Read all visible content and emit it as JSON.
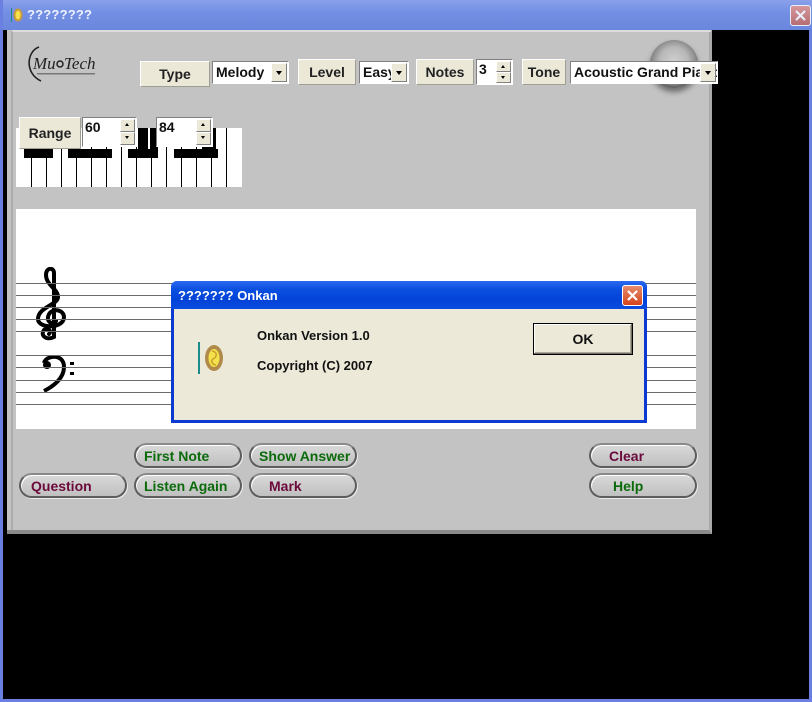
{
  "window": {
    "title": "????????",
    "close_label": "Close"
  },
  "toolbar": {
    "logo_text": "MuTech",
    "type_label": "Type",
    "type_value": "Melody",
    "level_label": "Level",
    "level_value": "Easy",
    "notes_label": "Notes",
    "notes_value": "3",
    "tone_label": "Tone",
    "tone_value": "Acoustic Grand Piano"
  },
  "range": {
    "label": "Range",
    "low_value": "60",
    "high_value": "84"
  },
  "buttons": {
    "first_note": "First Note",
    "show_answer": "Show Answer",
    "question": "Question",
    "listen_again": "Listen Again",
    "mark": "Mark",
    "clear": "Clear",
    "help": "Help"
  },
  "dialog": {
    "title": "??????? Onkan",
    "version": "Onkan Version 1.0",
    "copyright": "Copyright (C) 2007",
    "ok_label": "OK"
  },
  "colors": {
    "green_text": "#0b6b0b",
    "maroon_text": "#6b0a3a",
    "dialog_title": "#0a4fe0",
    "panel": "#c3c3c3"
  }
}
